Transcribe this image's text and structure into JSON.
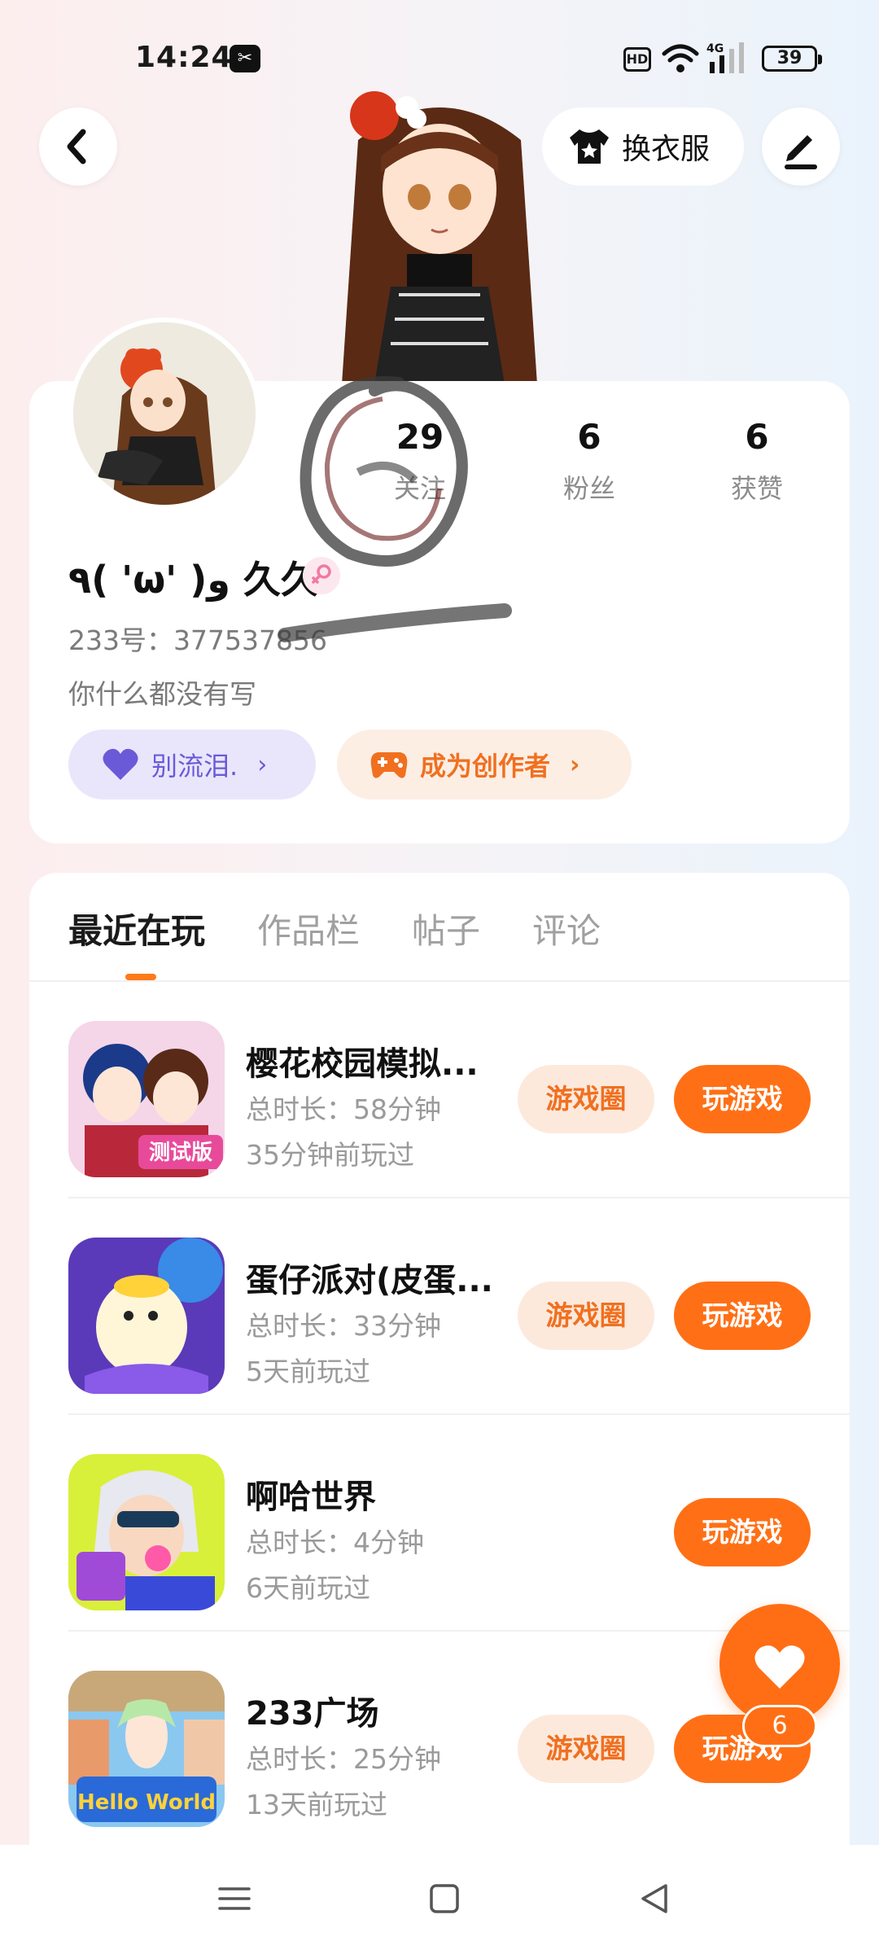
{
  "status_bar": {
    "time": "14:24",
    "hd_label": "HD",
    "network_label": "4G",
    "battery": "39"
  },
  "header": {
    "outfit_label": "换衣服"
  },
  "profile": {
    "stats": [
      {
        "value": "29",
        "label": "关注"
      },
      {
        "value": "6",
        "label": "粉丝"
      },
      {
        "value": "6",
        "label": "获赞"
      }
    ],
    "nickname": "٩( 'ω' )و 久久",
    "uid_label": "233号：",
    "uid_value": "377537856",
    "bio": "你什么都没有写",
    "mood_label": "别流泪.",
    "creator_label": "成为创作者"
  },
  "tabs": [
    "最近在玩",
    "作品栏",
    "帖子",
    "评论"
  ],
  "games": [
    {
      "name": "樱花校园模拟...",
      "duration": "总时长：58分钟",
      "last_played": "35分钟前玩过",
      "circle_label": "游戏圈",
      "play_label": "玩游戏",
      "badge": "测试版"
    },
    {
      "name": "蛋仔派对(皮蛋...",
      "duration": "总时长：33分钟",
      "last_played": "5天前玩过",
      "circle_label": "游戏圈",
      "play_label": "玩游戏"
    },
    {
      "name": "啊哈世界",
      "duration": "总时长：4分钟",
      "last_played": "6天前玩过",
      "play_label": "玩游戏"
    },
    {
      "name": "233广场",
      "duration": "总时长：25分钟",
      "last_played": "13天前玩过",
      "circle_label": "游戏圈",
      "play_label": "玩游戏",
      "thumb_text": "Hello World"
    }
  ],
  "like_count": "6",
  "colors": {
    "accent": "#ff7016",
    "accent_light": "#fde9dc",
    "mood": "#6a5ad8"
  }
}
